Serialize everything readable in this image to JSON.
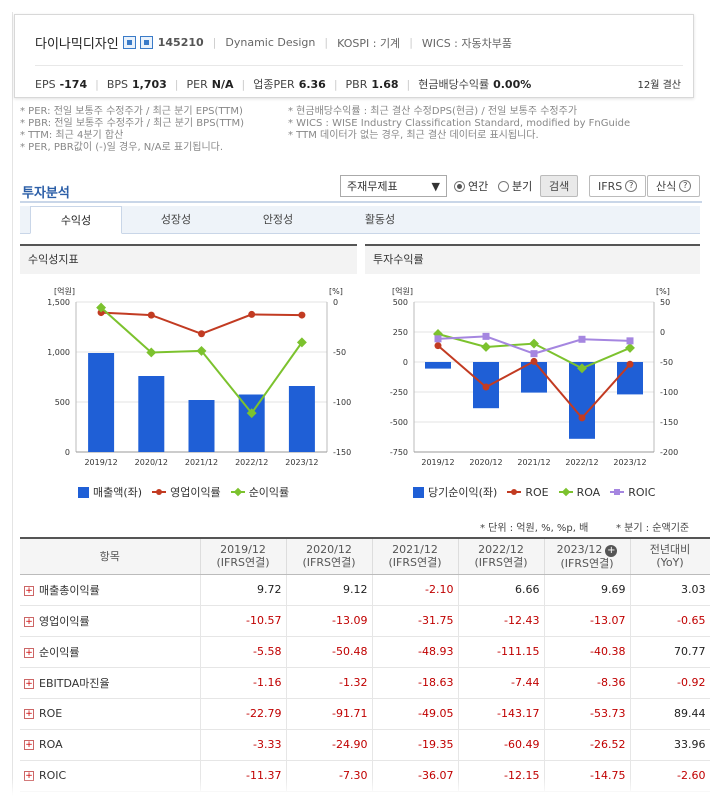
{
  "header": {
    "company": "다이나믹디자인",
    "code": "145210",
    "eng_name": "Dynamic Design",
    "market": "KOSPI : 기계",
    "wics": "WICS : 자동차부품",
    "stats": [
      {
        "label": "EPS",
        "value": "-174"
      },
      {
        "label": "BPS",
        "value": "1,703"
      },
      {
        "label": "PER",
        "value": "N/A"
      },
      {
        "label": "업종PER",
        "value": "6.36"
      },
      {
        "label": "PBR",
        "value": "1.68"
      },
      {
        "label": "현금배당수익률",
        "value": "0.00%"
      }
    ],
    "settlement": "12월 결산"
  },
  "notes": {
    "left": [
      "* PER: 전일 보통주 수정주가 / 최근 분기 EPS(TTM)",
      "* PBR: 전일 보통주 수정주가 / 최근 분기 BPS(TTM)",
      "* TTM: 최근 4분기 합산",
      "* PER, PBR값이 (-)일 경우, N/A로 표기됩니다."
    ],
    "right": [
      "* 현금배당수익률 : 최근 결산 수정DPS(현금) / 전일 보통주 수정주가",
      "* WICS : WISE Industry Classification Standard, modified by FnGuide",
      "* TTM 데이터가 없는 경우, 최근 결산 데이터로 표시됩니다."
    ]
  },
  "section": {
    "title": "투자분석",
    "select_value": "주재무제표",
    "radio_annual": "연간",
    "radio_quarter": "분기",
    "search_btn": "검색",
    "ifrs_btn": "IFRS",
    "formula_btn": "산식"
  },
  "tabs": [
    "수익성",
    "성장성",
    "안정성",
    "활동성"
  ],
  "colors": {
    "bar": "#1f5fd6",
    "red": "#c23b22",
    "green": "#7cc22e",
    "purple": "#a586e0"
  },
  "chart1": {
    "title": "수익성지표",
    "left_unit": "[억원]",
    "right_unit": "[%]",
    "legend": [
      "매출액(좌)",
      "영업이익률",
      "순이익률"
    ],
    "left_ticks": [
      "1,500",
      "1,000",
      "500",
      "0"
    ],
    "right_ticks": [
      "0",
      "-50",
      "-100",
      "-150"
    ],
    "x_labels": [
      "2019/12",
      "2020/12",
      "2021/12",
      "2022/12",
      "2023/12"
    ]
  },
  "chart2": {
    "title": "투자수익률",
    "left_unit": "[억원]",
    "right_unit": "[%]",
    "legend": [
      "당기순이익(좌)",
      "ROE",
      "ROA",
      "ROIC"
    ],
    "left_ticks": [
      "500",
      "250",
      "0",
      "-250",
      "-500",
      "-750"
    ],
    "right_ticks": [
      "50",
      "0",
      "-50",
      "-100",
      "-150",
      "-200"
    ],
    "x_labels": [
      "2019/12",
      "2020/12",
      "2021/12",
      "2022/12",
      "2023/12"
    ]
  },
  "chart_data": [
    {
      "type": "bar",
      "title": "수익성지표",
      "categories": [
        "2019/12",
        "2020/12",
        "2021/12",
        "2022/12",
        "2023/12"
      ],
      "ylim_left": [
        0,
        1500
      ],
      "ylim_right": [
        -150,
        0
      ],
      "series": [
        {
          "name": "매출액(좌)",
          "axis": "left",
          "kind": "bar",
          "values": [
            990,
            760,
            520,
            575,
            660
          ]
        },
        {
          "name": "영업이익률",
          "axis": "right",
          "kind": "line",
          "values": [
            -10.57,
            -13.09,
            -31.75,
            -12.43,
            -13.07
          ]
        },
        {
          "name": "순이익률",
          "axis": "right",
          "kind": "line",
          "values": [
            -5.58,
            -50.48,
            -48.93,
            -111.15,
            -40.38
          ]
        }
      ]
    },
    {
      "type": "bar",
      "title": "투자수익률",
      "categories": [
        "2019/12",
        "2020/12",
        "2021/12",
        "2022/12",
        "2023/12"
      ],
      "ylim_left": [
        -750,
        500
      ],
      "ylim_right": [
        -200,
        50
      ],
      "series": [
        {
          "name": "당기순이익(좌)",
          "axis": "left",
          "kind": "bar",
          "values": [
            -55,
            -385,
            -255,
            -640,
            -270
          ]
        },
        {
          "name": "ROE",
          "axis": "right",
          "kind": "line",
          "values": [
            -22.79,
            -91.71,
            -49.05,
            -143.17,
            -53.73
          ]
        },
        {
          "name": "ROA",
          "axis": "right",
          "kind": "line",
          "values": [
            -3.33,
            -24.9,
            -19.35,
            -60.49,
            -26.52
          ]
        },
        {
          "name": "ROIC",
          "axis": "right",
          "kind": "line",
          "values": [
            -11.37,
            -7.3,
            -36.07,
            -12.15,
            -14.75
          ]
        }
      ]
    }
  ],
  "unit_note": "* 단위 : 억원, %, %p, 배",
  "unit_note2": "* 분기 : 순액기준",
  "table": {
    "header_item": "항목",
    "columns": [
      {
        "year": "2019/12",
        "sub": "(IFRS연결)"
      },
      {
        "year": "2020/12",
        "sub": "(IFRS연결)"
      },
      {
        "year": "2021/12",
        "sub": "(IFRS연결)"
      },
      {
        "year": "2022/12",
        "sub": "(IFRS연결)"
      },
      {
        "year": "2023/12",
        "sub": "(IFRS연결)"
      },
      {
        "year": "전년대비",
        "sub": "(YoY)"
      }
    ],
    "rows": [
      {
        "label": "매출총이익률",
        "values": [
          "9.72",
          "9.12",
          "-2.10",
          "6.66",
          "9.69",
          "3.03"
        ]
      },
      {
        "label": "영업이익률",
        "values": [
          "-10.57",
          "-13.09",
          "-31.75",
          "-12.43",
          "-13.07",
          "-0.65"
        ]
      },
      {
        "label": "순이익률",
        "values": [
          "-5.58",
          "-50.48",
          "-48.93",
          "-111.15",
          "-40.38",
          "70.77"
        ]
      },
      {
        "label": "EBITDA마진율",
        "values": [
          "-1.16",
          "-1.32",
          "-18.63",
          "-7.44",
          "-8.36",
          "-0.92"
        ]
      },
      {
        "label": "ROE",
        "values": [
          "-22.79",
          "-91.71",
          "-49.05",
          "-143.17",
          "-53.73",
          "89.44"
        ]
      },
      {
        "label": "ROA",
        "values": [
          "-3.33",
          "-24.90",
          "-19.35",
          "-60.49",
          "-26.52",
          "33.96"
        ]
      },
      {
        "label": "ROIC",
        "values": [
          "-11.37",
          "-7.30",
          "-36.07",
          "-12.15",
          "-14.75",
          "-2.60"
        ]
      }
    ]
  }
}
